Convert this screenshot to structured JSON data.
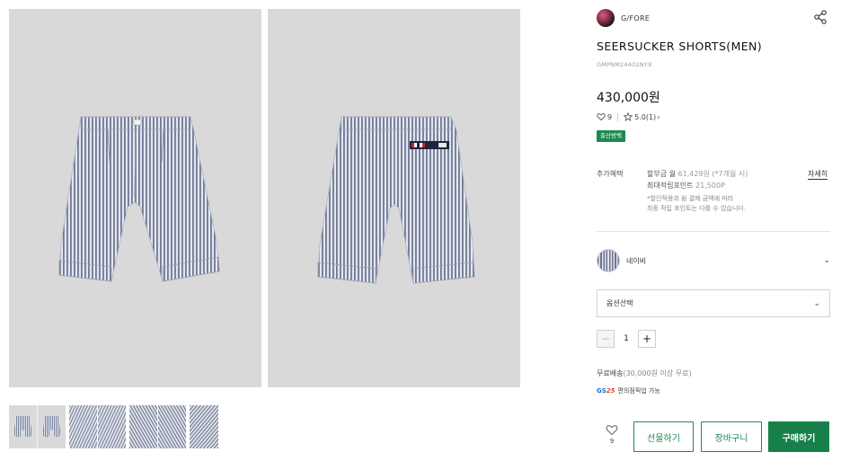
{
  "gallery": {
    "main_images": [
      {
        "view": "front"
      },
      {
        "view": "back"
      }
    ],
    "thumbnails": [
      {
        "view": "front-back",
        "active": true
      },
      {
        "view": "detail-1",
        "active": false
      },
      {
        "view": "detail-2",
        "active": false
      },
      {
        "view": "detail-3",
        "active": false
      }
    ]
  },
  "product": {
    "brand": "G/FORE",
    "title": "SEERSUCKER SHORTS(MEN)",
    "code": "GMPNM24402NYX",
    "price": "430,000원",
    "likes": "9",
    "rating": "5.0(1)",
    "badge": "출산방벡"
  },
  "benefits": {
    "label": "추가혜택",
    "installment_prefix": "할부금 월",
    "installment_value": "61,429원 (*7개월 시)",
    "points_prefix": "최대적립포인트",
    "points_value": "21,500P",
    "note_line1": "*할인적용과 쉼 결제 금액에 따라",
    "note_line2": "최종 적립 포인트는 다를 수 있습니다.",
    "detail_link": "자세히"
  },
  "options": {
    "color_name": "네이비",
    "option_placeholder": "옵션선택",
    "quantity": "1",
    "minus": "−",
    "plus": "+"
  },
  "shipping": {
    "free_label": "무료배송",
    "free_condition": "(30,000원 이상 무료)",
    "pickup_logo_prefix": "GS",
    "pickup_logo_number": "25",
    "pickup_text": "편의점픽업 가능"
  },
  "actions": {
    "wish_count": "9",
    "gift": "선물하기",
    "cart": "장바구니",
    "buy": "구매하기"
  },
  "colors": {
    "accent": "#1c8a52",
    "buy_button": "#17804a",
    "stripe_navy": "#6d7590"
  }
}
